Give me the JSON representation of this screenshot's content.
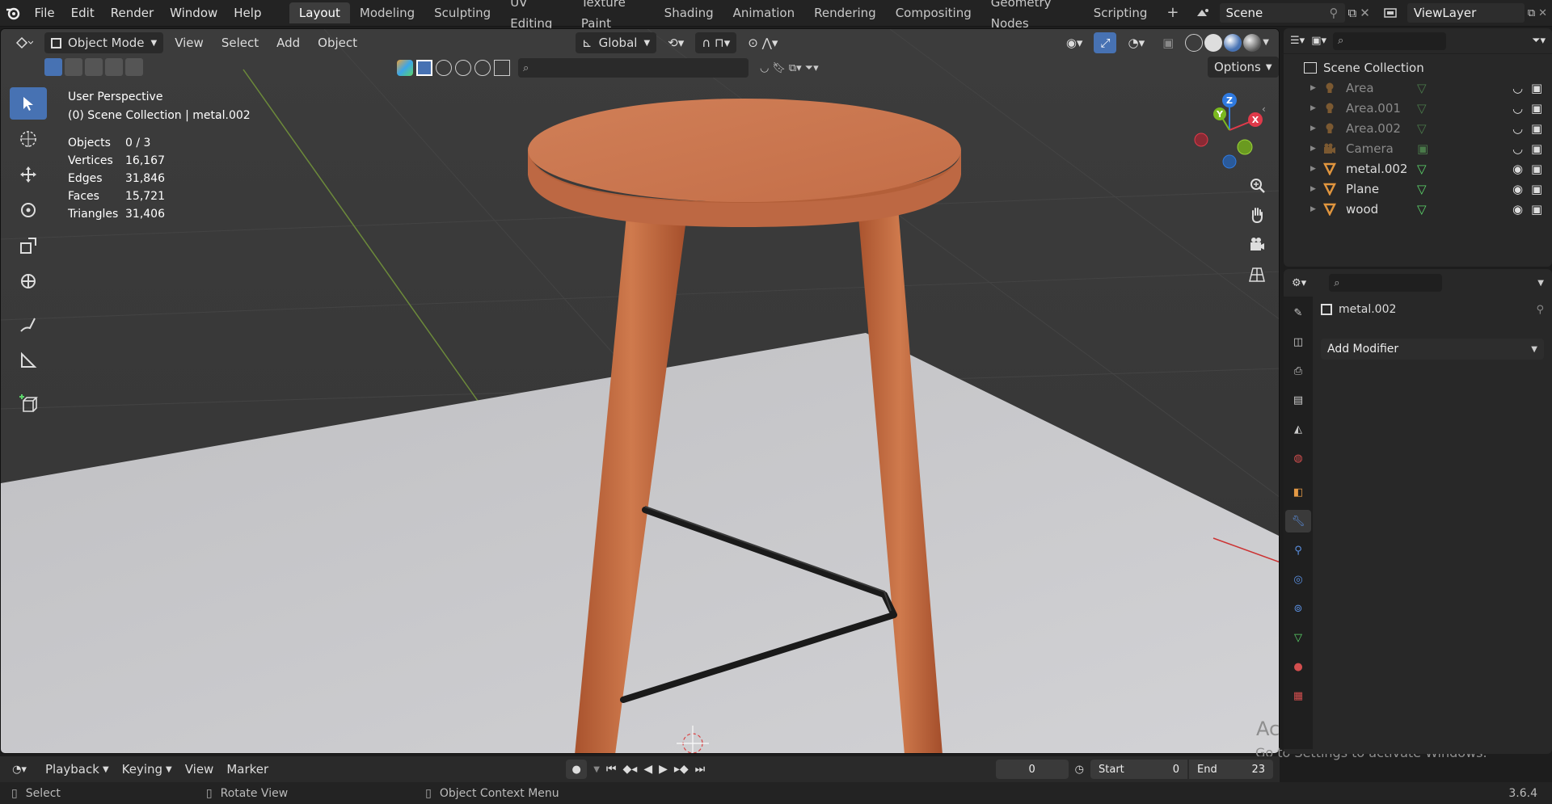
{
  "topbar": {
    "menus": [
      "File",
      "Edit",
      "Render",
      "Window",
      "Help"
    ],
    "workspace_tabs": [
      "Layout",
      "Modeling",
      "Sculpting",
      "UV Editing",
      "Texture Paint",
      "Shading",
      "Animation",
      "Rendering",
      "Compositing",
      "Geometry Nodes",
      "Scripting"
    ],
    "active_tab": "Layout",
    "add_tab": "+",
    "scene": "Scene",
    "view_layer": "ViewLayer"
  },
  "viewport_header": {
    "mode": "Object Mode",
    "menus": [
      "View",
      "Select",
      "Add",
      "Object"
    ],
    "transform_orientation": "Global",
    "options": "Options"
  },
  "overlay_text": {
    "perspective": "User Perspective",
    "collection": "(0) Scene Collection | metal.002",
    "stats": [
      {
        "label": "Objects",
        "value": "0 / 3"
      },
      {
        "label": "Vertices",
        "value": "16,167"
      },
      {
        "label": "Edges",
        "value": "31,846"
      },
      {
        "label": "Faces",
        "value": "15,721"
      },
      {
        "label": "Triangles",
        "value": "31,406"
      }
    ]
  },
  "gizmo": {
    "z": "Z",
    "y": "Y",
    "x": "X"
  },
  "outliner": {
    "title": "Scene Collection",
    "items": [
      {
        "name": "Area",
        "icon": "light-icon",
        "dim": true
      },
      {
        "name": "Area.001",
        "icon": "light-icon",
        "dim": true
      },
      {
        "name": "Area.002",
        "icon": "light-icon",
        "dim": true
      },
      {
        "name": "Camera",
        "icon": "camera-icon",
        "dim": true
      },
      {
        "name": "metal.002",
        "icon": "mesh-icon",
        "dim": false
      },
      {
        "name": "Plane",
        "icon": "mesh-icon",
        "dim": false
      },
      {
        "name": "wood",
        "icon": "mesh-icon",
        "dim": false
      }
    ]
  },
  "properties": {
    "object_name": "metal.002",
    "add_modifier": "Add Modifier"
  },
  "watermark": {
    "line1": "Activate Windows",
    "line2": "Go to Settings to activate Windows."
  },
  "timeline": {
    "menus": [
      "Playback",
      "Keying",
      "View",
      "Marker"
    ],
    "current_frame": "0",
    "start_label": "Start",
    "start": "0",
    "end_label": "End",
    "end": "23"
  },
  "statusbar": {
    "select": "Select",
    "rotate": "Rotate View",
    "context": "Object Context Menu",
    "version": "3.6.4"
  },
  "colors": {
    "accent": "#4772b3",
    "wood": "#c4683f",
    "floor": "#c9c9cc"
  }
}
